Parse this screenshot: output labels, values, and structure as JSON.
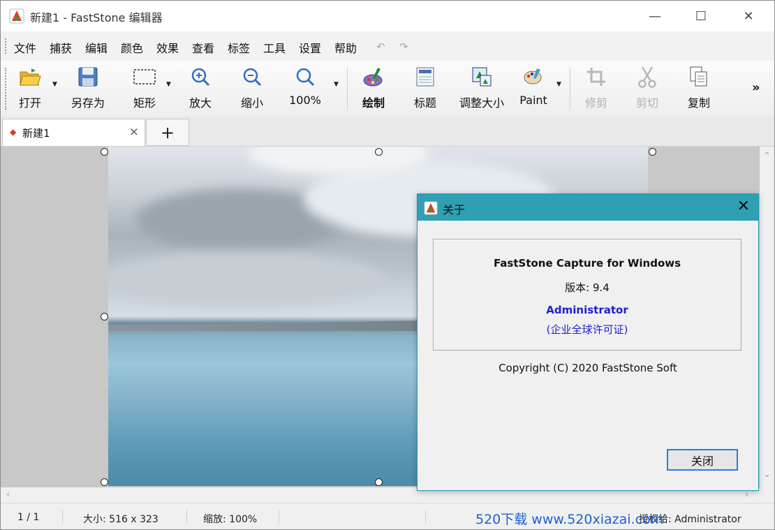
{
  "window": {
    "title": "新建1 - FastStone 编辑器",
    "minimize": "—",
    "maximize": "☐",
    "close": "✕"
  },
  "menu": [
    "文件",
    "捕获",
    "编辑",
    "颜色",
    "效果",
    "查看",
    "标签",
    "工具",
    "设置",
    "帮助"
  ],
  "toolbar": {
    "open": "打开",
    "save_as": "另存为",
    "rect": "矩形",
    "zoom_in": "放大",
    "zoom_out": "缩小",
    "zoom_100": "100%",
    "draw": "绘制",
    "caption": "标题",
    "resize": "调整大小",
    "paint": "Paint",
    "crop": "修剪",
    "cut": "剪切",
    "copy": "复制",
    "more": "»"
  },
  "tabs": {
    "active": "新建1",
    "close": "×",
    "add": "+"
  },
  "status": {
    "page": "1 / 1",
    "size": "大小: 516 x 323",
    "zoom": "缩放: 100%",
    "license": "授权给: Administrator",
    "watermark": "520下载 www.520xiazai.com"
  },
  "about_dialog": {
    "title": "关于",
    "close": "✕",
    "product": "FastStone Capture for Windows",
    "version": "版本: 9.4",
    "user": "Administrator",
    "license_type": "(企业全球许可证)",
    "copyright": "Copyright (C) 2020 FastStone Soft",
    "close_button": "关闭"
  },
  "colors": {
    "dialog_title": "#2fa0b4",
    "user_text": "#1f1fd0",
    "tab_marker": "#d43b2a",
    "watermark": "#1f5fd0"
  }
}
